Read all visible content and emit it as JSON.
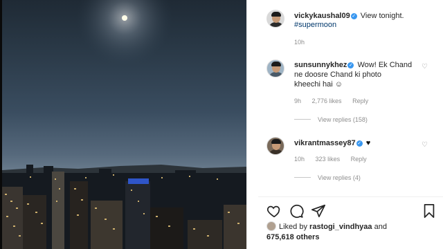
{
  "post": {
    "author": "vickykaushal09",
    "caption": "View tonight.",
    "hashtag": "#supermoon",
    "time": "10h"
  },
  "comments": [
    {
      "user": "sunsunnykhez",
      "text_line1": "Wow! Ek Chand",
      "text_line2": "ne doosre Chand ki photo",
      "text_line3": "kheechi hai ☺",
      "time": "9h",
      "likes": "2,776 likes",
      "reply": "Reply",
      "view_replies": "View replies (158)"
    },
    {
      "user": "vikrantmassey87",
      "text": "♥",
      "time": "10h",
      "likes": "323 likes",
      "reply": "Reply",
      "view_replies": "View replies (4)"
    }
  ],
  "likes_summary": {
    "prefix": "Liked by",
    "user": "rastogi_vindhyaa",
    "and": "and",
    "count": "675,618 others"
  },
  "icons": [
    "heart-icon",
    "comment-icon",
    "share-icon",
    "bookmark-icon",
    "verified-badge-icon"
  ],
  "colors": {
    "verified": "#3897f0",
    "hashtag": "#00376b",
    "muted": "#8e8e8e"
  }
}
